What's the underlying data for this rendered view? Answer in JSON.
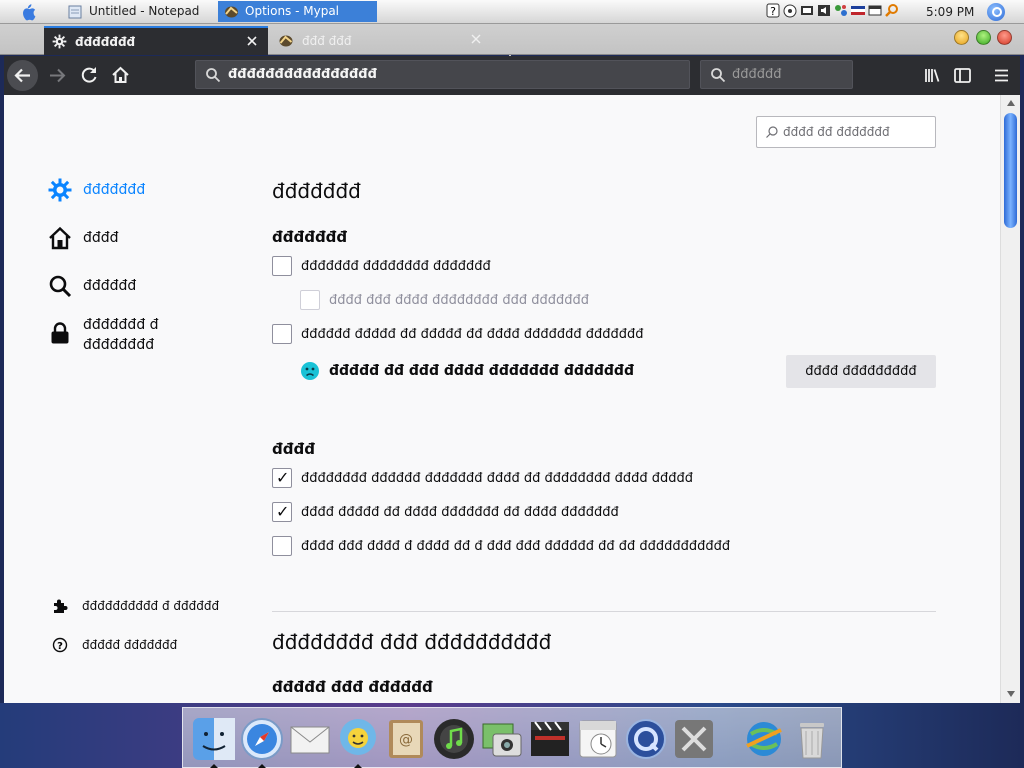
{
  "os_taskbar": {
    "tasks": [
      {
        "label": "Untitled - Notepad"
      },
      {
        "label": "Options - Mypal"
      }
    ],
    "clock": "5:09 PM"
  },
  "browser": {
    "tabs": [
      {
        "label": "đđđđđđđ"
      },
      {
        "label": "đđđ đđđ"
      }
    ],
    "url_text": "đđđđđđđđđđđđđđđđ",
    "search_placeholder": "đđđđđđ"
  },
  "preferences": {
    "find_placeholder": "đđđđ đđ đđđđđđđ",
    "categories": [
      {
        "label": "đđđđđđđ"
      },
      {
        "label": "đđđđ"
      },
      {
        "label": "đđđđđđ"
      },
      {
        "label": "đđđđđđđ đ đđđđđđđđ"
      }
    ],
    "bottom_links": [
      {
        "label": "đđđđđđđđđđ đ đđđđđđ"
      },
      {
        "label": "đđđđđ đđđđđđđ"
      }
    ],
    "heading_general": "đđđđđđđ",
    "startup": {
      "heading": "đđđđđđđ",
      "options": [
        {
          "label": "đđđđđđđ đđđđđđđđ đđđđđđđ"
        },
        {
          "label": "đđđđ đđđ đđđđ đđđđđđđđ đđđ đđđđđđđ"
        },
        {
          "label": "đđđđđđ đđđđđ đđ đđđđđ đđ đđđđ đđđđđđđ đđđđđđđ"
        }
      ],
      "default_text": "đđđđđ đđ đđđ đđđđ đđđđđđđ đđđđđđđ",
      "default_button": "đđđđ đđđđđđđđđ"
    },
    "tabs_section": {
      "heading": "đđđđ",
      "options": [
        {
          "label": "đđđđđđđđ đđđđđđ đđđđđđđ đđđđ đđ đđđđđđđđ đđđđ đđđđđ"
        },
        {
          "label": "đđđđ đđđđđ đđ đđđđ đđđđđđđ đđ đđđđ đđđđđđđ"
        },
        {
          "label": "đđđđ đđđ đđđđ đ đđđđ đđ đ đđđ đđđ đđđđđđ đđ đđ đđđđđđđđđđđ"
        }
      ]
    },
    "heading_performance": "đđđđđđđđ đđđ đđđđđđđđđđ",
    "heading_language": "đđđđđ đđđ đđđđđđ"
  }
}
